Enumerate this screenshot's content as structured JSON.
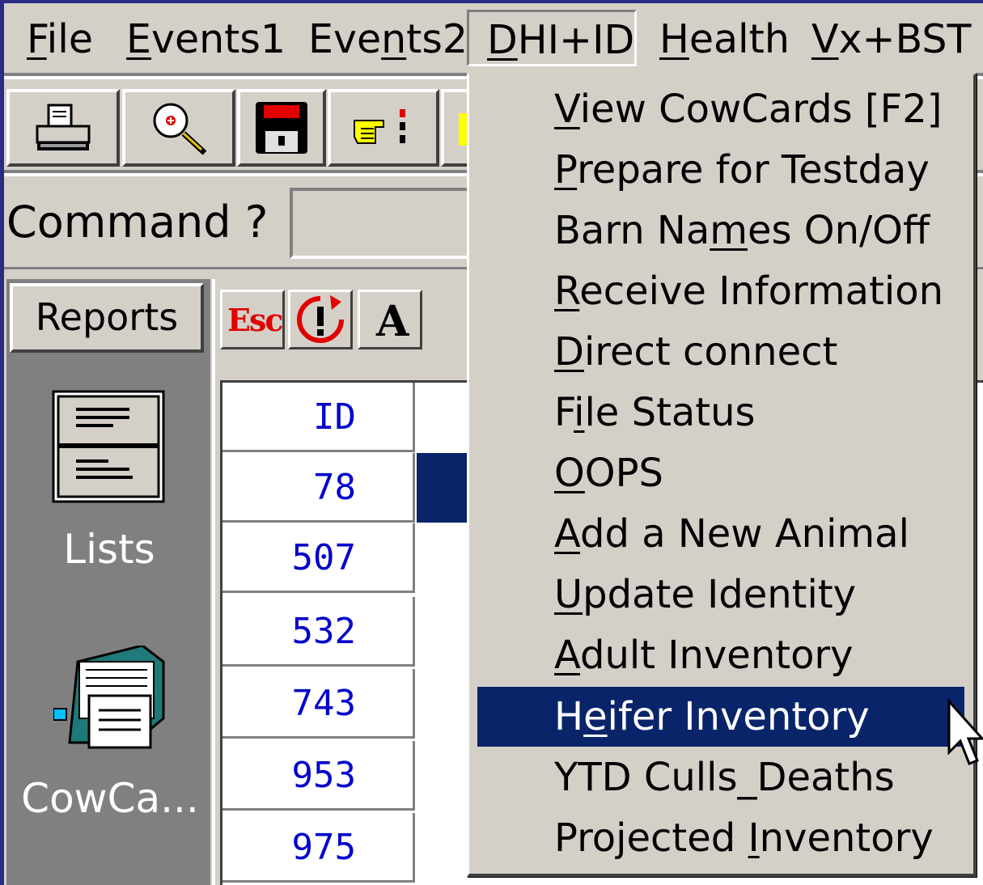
{
  "menubar": {
    "items": [
      {
        "pre": "",
        "acc": "F",
        "post": "ile"
      },
      {
        "pre": "",
        "acc": "E",
        "post": "vents1"
      },
      {
        "pre": "Eve",
        "acc": "n",
        "post": "ts2"
      },
      {
        "pre": "",
        "acc": "D",
        "post": "HI+ID"
      },
      {
        "pre": "",
        "acc": "H",
        "post": "ealth"
      },
      {
        "pre": "",
        "acc": "V",
        "post": "x+BST"
      }
    ]
  },
  "toolbar": {
    "buttons": [
      "print-icon",
      "find-cow-icon",
      "save-disk-icon",
      "pointing-hand-icon"
    ]
  },
  "command": {
    "label": "Command ?",
    "value": ""
  },
  "sidebar": {
    "reports_label": "Reports",
    "lists_label": "Lists",
    "cowcards_label": "CowCa..."
  },
  "grid_toolbar": {
    "esc_label": "Esc",
    "a_label": "A"
  },
  "grid": {
    "header": "ID",
    "rows": [
      "78",
      "507",
      "532",
      "743",
      "953",
      "975"
    ],
    "selected_row": "78"
  },
  "dropdown": {
    "open_menu": "DHI+ID",
    "items": [
      {
        "pre": "",
        "acc": "V",
        "post": "iew CowCards [F2]"
      },
      {
        "pre": "",
        "acc": "P",
        "post": "repare for Testday"
      },
      {
        "pre": "Barn Na",
        "acc": "m",
        "post": "es On/Off"
      },
      {
        "pre": "",
        "acc": "R",
        "post": "eceive Information"
      },
      {
        "pre": "",
        "acc": "D",
        "post": "irect connect"
      },
      {
        "pre": "F",
        "acc": "i",
        "post": "le Status"
      },
      {
        "pre": "",
        "acc": "O",
        "post": "OPS"
      },
      {
        "pre": "",
        "acc": "A",
        "post": "dd a New Animal"
      },
      {
        "pre": "",
        "acc": "U",
        "post": "pdate Identity"
      },
      {
        "pre": "",
        "acc": "A",
        "post": "dult Inventory"
      },
      {
        "pre": "H",
        "acc": "e",
        "post": "ifer Inventory"
      },
      {
        "pre": "YTD Culls_Deaths",
        "acc": "",
        "post": ""
      },
      {
        "pre": "Projected ",
        "acc": "I",
        "post": "nventory"
      }
    ],
    "selected_index": 10
  },
  "colors": {
    "frame": "#2b2b86",
    "face": "#d4d0c8",
    "highlight": "#0a246a",
    "id_text": "#0000cc"
  }
}
